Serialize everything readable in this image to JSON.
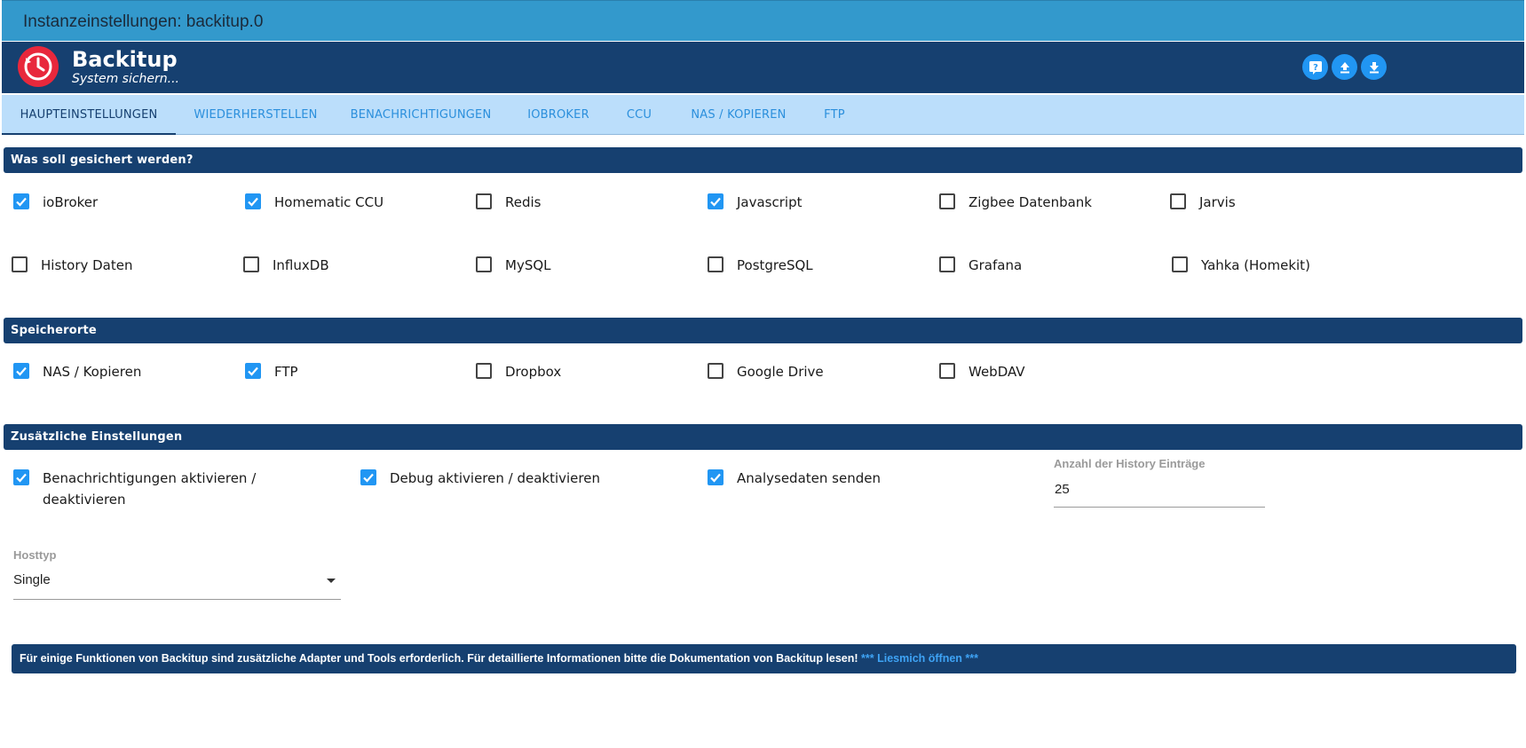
{
  "window": {
    "title": "Instanzeinstellungen: backitup.0"
  },
  "header": {
    "app_name": "Backitup",
    "subtitle": "System sichern...",
    "buttons": [
      {
        "icon": "help-icon"
      },
      {
        "icon": "upload-icon"
      },
      {
        "icon": "download-icon"
      }
    ]
  },
  "tabs": [
    {
      "label": "HAUPTEINSTELLUNGEN",
      "active": true
    },
    {
      "label": "WIEDERHERSTELLEN",
      "active": false
    },
    {
      "label": "BENACHRICHTIGUNGEN",
      "active": false
    },
    {
      "label": "IOBROKER",
      "active": false
    },
    {
      "label": "CCU",
      "active": false
    },
    {
      "label": "NAS / KOPIEREN",
      "active": false
    },
    {
      "label": "FTP",
      "active": false
    }
  ],
  "sections": {
    "backup": {
      "title": "Was soll gesichert werden?",
      "items": [
        {
          "label": "ioBroker",
          "checked": true
        },
        {
          "label": "Homematic CCU",
          "checked": true
        },
        {
          "label": "Redis",
          "checked": false
        },
        {
          "label": "Javascript",
          "checked": true
        },
        {
          "label": "Zigbee Datenbank",
          "checked": false
        },
        {
          "label": "Jarvis",
          "checked": false
        },
        {
          "label": "History Daten",
          "checked": false
        },
        {
          "label": "InfluxDB",
          "checked": false
        },
        {
          "label": "MySQL",
          "checked": false
        },
        {
          "label": "PostgreSQL",
          "checked": false
        },
        {
          "label": "Grafana",
          "checked": false
        },
        {
          "label": "Yahka (Homekit)",
          "checked": false
        }
      ]
    },
    "storage": {
      "title": "Speicherorte",
      "items": [
        {
          "label": "NAS / Kopieren",
          "checked": true
        },
        {
          "label": "FTP",
          "checked": true
        },
        {
          "label": "Dropbox",
          "checked": false
        },
        {
          "label": "Google Drive",
          "checked": false
        },
        {
          "label": "WebDAV",
          "checked": false
        }
      ]
    },
    "extra": {
      "title": "Zusätzliche Einstellungen",
      "items": [
        {
          "label": "Benachrichtigungen aktivieren / deaktivieren",
          "checked": true
        },
        {
          "label": "Debug aktivieren / deaktivieren",
          "checked": true
        },
        {
          "label": "Analysedaten senden",
          "checked": true
        }
      ],
      "history_count": {
        "label": "Anzahl der History Einträge",
        "value": "25"
      },
      "hosttype": {
        "label": "Hosttyp",
        "value": "Single"
      }
    }
  },
  "footer": {
    "text": "Für einige Funktionen von Backitup sind zusätzliche Adapter und Tools erforderlich. Für detaillierte Informationen bitte die Dokumentation von Backitup lesen! ",
    "link": "*** Liesmich öffnen ***"
  },
  "colors": {
    "title_bar": "#3399cc",
    "header": "#164070",
    "tabs_bg": "#bbdefb",
    "accent": "#2196f3",
    "logo": "#e8283c"
  }
}
